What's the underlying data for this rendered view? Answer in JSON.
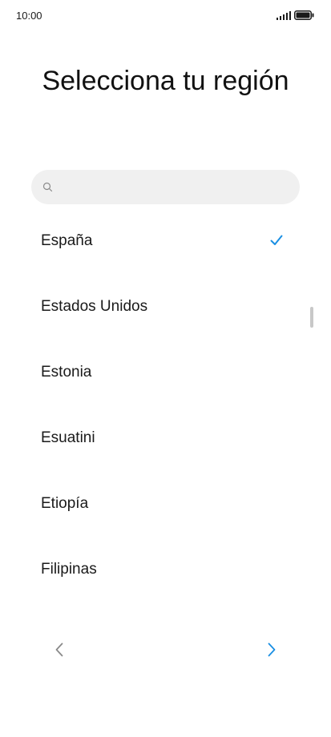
{
  "status_bar": {
    "time": "10:00",
    "icons": [
      "signal-icon",
      "battery-icon"
    ]
  },
  "header": {
    "title": "Selecciona tu región"
  },
  "search": {
    "placeholder": "",
    "value": "",
    "icon": "search-icon"
  },
  "regions": {
    "items": [
      {
        "label": "España",
        "selected": true
      },
      {
        "label": "Estados Unidos",
        "selected": false
      },
      {
        "label": "Estonia",
        "selected": false
      },
      {
        "label": "Esuatini",
        "selected": false
      },
      {
        "label": "Etiopía",
        "selected": false
      },
      {
        "label": "Filipinas",
        "selected": false
      }
    ]
  },
  "navigation": {
    "back_icon": "chevron-left-icon",
    "next_icon": "chevron-right-icon"
  },
  "colors": {
    "accent": "#1a8fe3",
    "back_arrow": "#8a8a8a",
    "search_bg": "#f0f0f0",
    "scrollbar": "#c8c8c8"
  }
}
